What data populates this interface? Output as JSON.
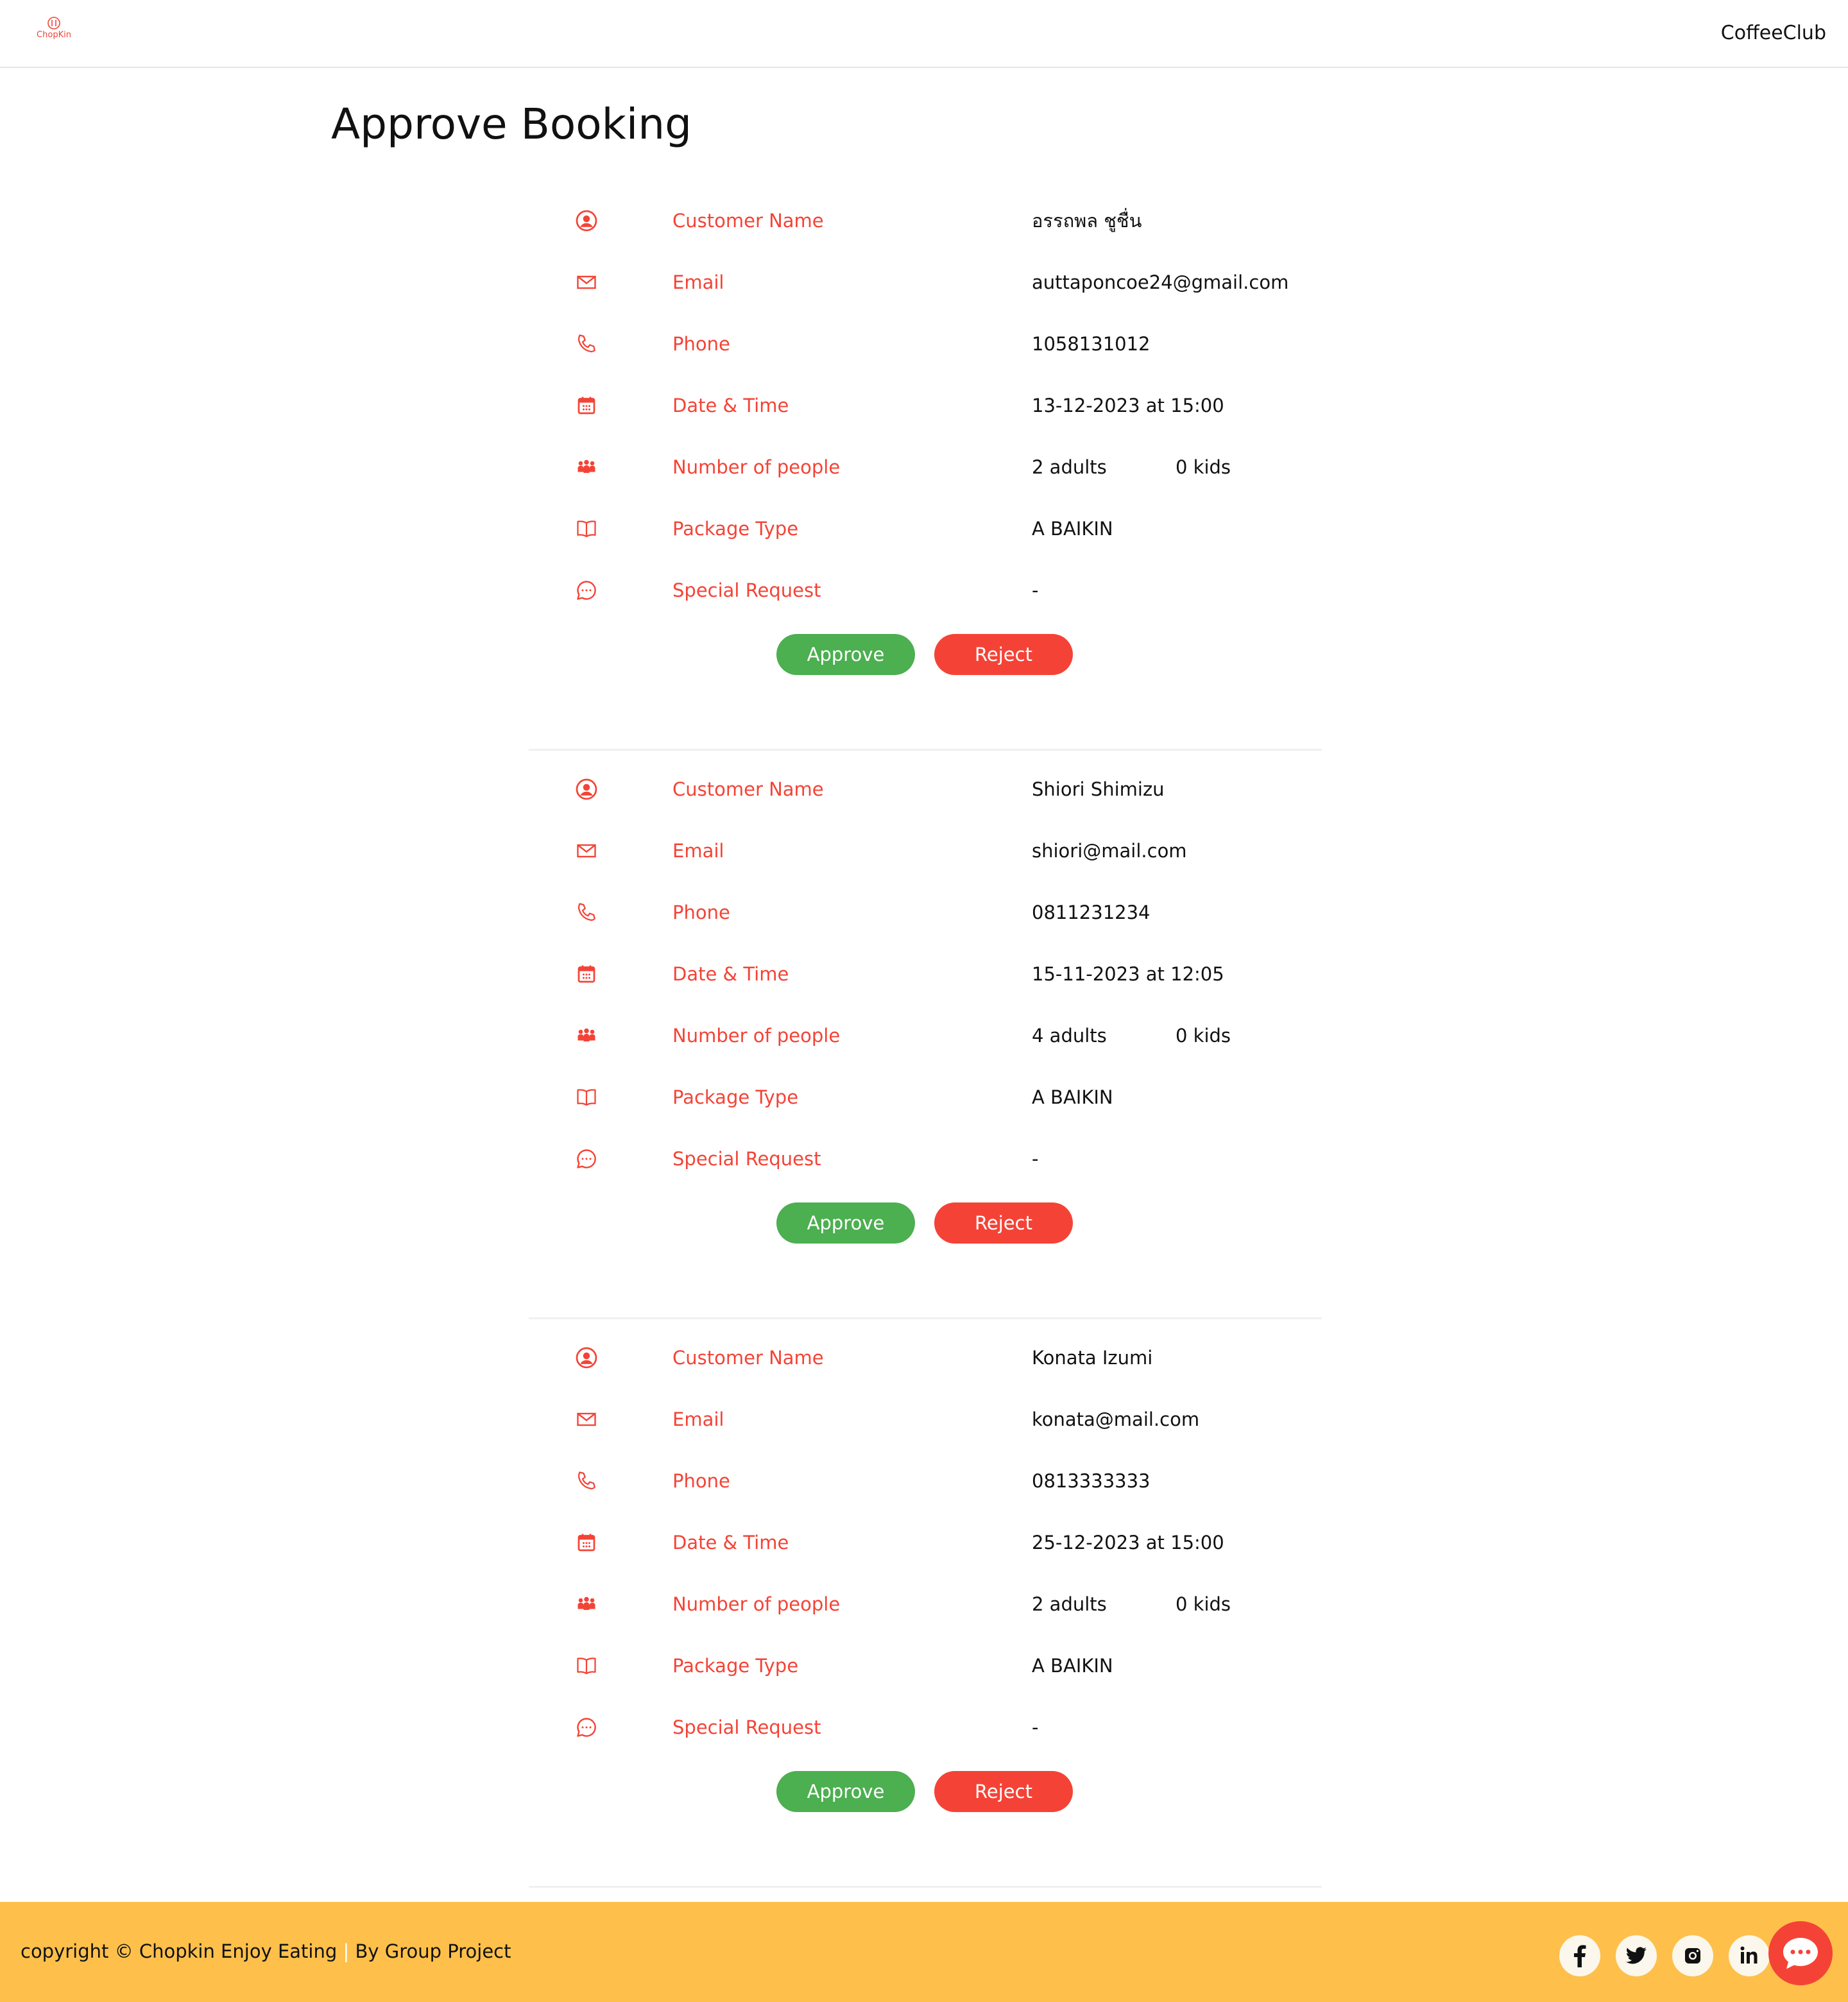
{
  "header": {
    "logo_text": "ChopKin",
    "brand": "CoffeeClub"
  },
  "page_title": "Approve Booking",
  "field_labels": {
    "customer_name": "Customer Name",
    "email": "Email",
    "phone": "Phone",
    "date_time": "Date & Time",
    "people": "Number of people",
    "package": "Package Type",
    "special": "Special Request"
  },
  "bookings": [
    {
      "customer_name": "อรรถพล ชูชื่น",
      "email": "auttaponcoe24@gmail.com",
      "phone": "1058131012",
      "date_time": "13-12-2023 at 15:00",
      "adults": "2 adults",
      "kids": "0 kids",
      "package": "A BAIKIN",
      "special": "-",
      "approve_label": "Approve",
      "reject_label": "Reject"
    },
    {
      "customer_name": "Shiori Shimizu",
      "email": "shiori@mail.com",
      "phone": "0811231234",
      "date_time": "15-11-2023 at 12:05",
      "adults": "4 adults",
      "kids": "0 kids",
      "package": "A BAIKIN",
      "special": "-",
      "approve_label": "Approve",
      "reject_label": "Reject"
    },
    {
      "customer_name": "Konata Izumi",
      "email": "konata@mail.com",
      "phone": "0813333333",
      "date_time": "25-12-2023 at 15:00",
      "adults": "2 adults",
      "kids": "0 kids",
      "package": "A BAIKIN",
      "special": "-",
      "approve_label": "Approve",
      "reject_label": "Reject"
    }
  ],
  "footer": {
    "copyright": "copyright © Chopkin Enjoy Eating",
    "separator": "|",
    "by": "By Group Project",
    "social_icons": [
      "facebook-icon",
      "twitter-icon",
      "instagram-icon",
      "linkedin-icon"
    ],
    "chat_icon": "chat-bubble-icon"
  },
  "colors": {
    "accent": "#f44336",
    "approve": "#4caf50",
    "footer": "#fec04b"
  }
}
